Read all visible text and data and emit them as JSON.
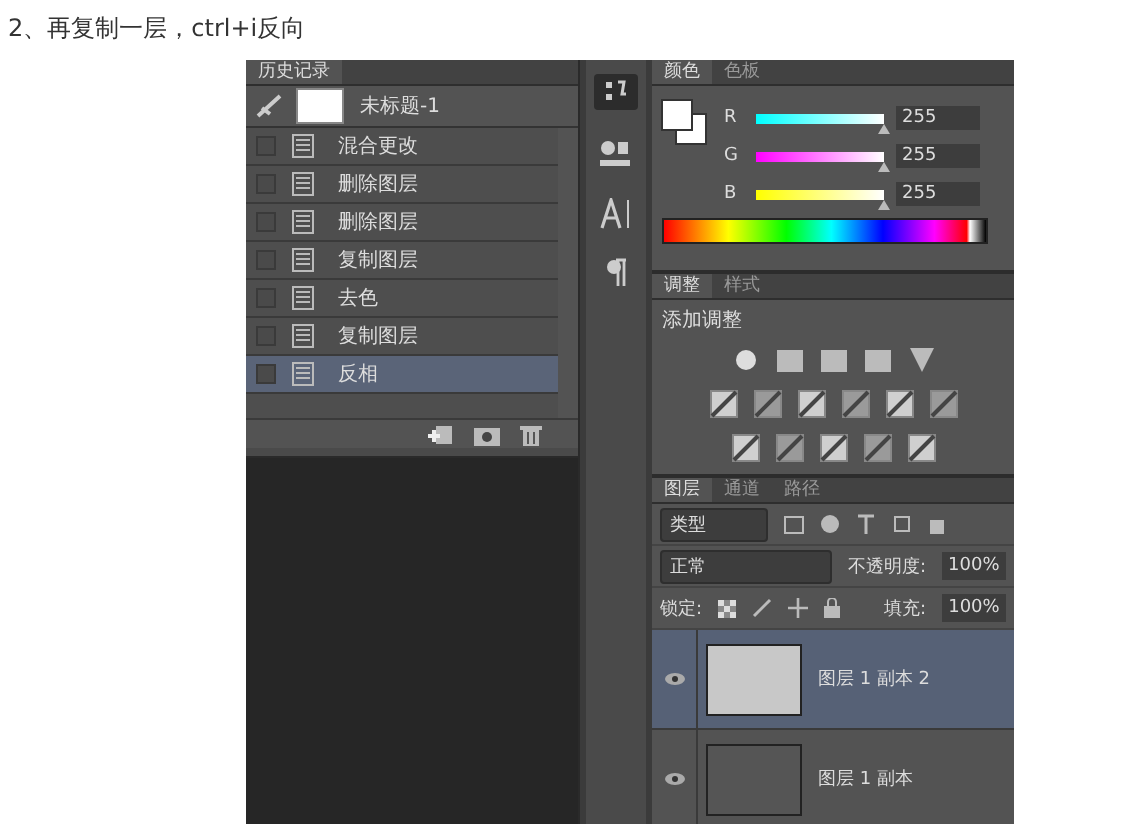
{
  "caption": "2、再复制一层，ctrl+i反向",
  "history_panel": {
    "tabs": [
      {
        "label": "历史记录",
        "selected": true
      }
    ],
    "snapshot": {
      "label": "未标题-1"
    },
    "items": [
      {
        "label": "混合更改",
        "selected": false
      },
      {
        "label": "删除图层",
        "selected": false
      },
      {
        "label": "删除图层",
        "selected": false
      },
      {
        "label": "复制图层",
        "selected": false
      },
      {
        "label": "去色",
        "selected": false
      },
      {
        "label": "复制图层",
        "selected": false
      },
      {
        "label": "反相",
        "selected": true
      }
    ]
  },
  "color_panel": {
    "tabs": [
      {
        "label": "颜色",
        "selected": true
      },
      {
        "label": "色板",
        "selected": false
      }
    ],
    "channels": [
      {
        "name": "R",
        "value": "255",
        "level": 1
      },
      {
        "name": "G",
        "value": "255",
        "level": 1
      },
      {
        "name": "B",
        "value": "255",
        "level": 1
      }
    ]
  },
  "adjustments_panel": {
    "tabs": [
      {
        "label": "调整",
        "selected": true
      },
      {
        "label": "样式",
        "selected": false
      }
    ],
    "heading": "添加调整"
  },
  "layers_panel": {
    "tabs": [
      {
        "label": "图层",
        "selected": true
      },
      {
        "label": "通道",
        "selected": false
      },
      {
        "label": "路径",
        "selected": false
      }
    ],
    "filter": {
      "value": "类型"
    },
    "blend_mode": {
      "value": "正常"
    },
    "opacity": {
      "label": "不透明度:",
      "value": "100%"
    },
    "lock_label": "锁定:",
    "fill": {
      "label": "填充:",
      "value": "100%"
    },
    "layers": [
      {
        "name": "图层 1 副本 2",
        "visible": true,
        "selected": true
      },
      {
        "name": "图层 1 副本",
        "visible": true,
        "selected": false
      }
    ]
  }
}
